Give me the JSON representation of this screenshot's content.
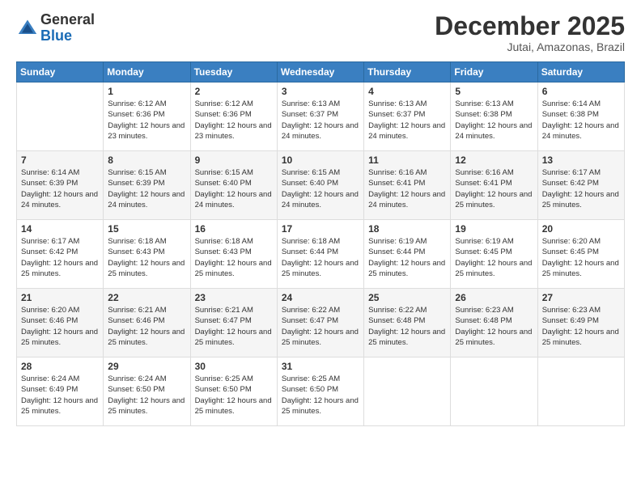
{
  "logo": {
    "text_general": "General",
    "text_blue": "Blue"
  },
  "header": {
    "month": "December 2025",
    "location": "Jutai, Amazonas, Brazil"
  },
  "weekdays": [
    "Sunday",
    "Monday",
    "Tuesday",
    "Wednesday",
    "Thursday",
    "Friday",
    "Saturday"
  ],
  "weeks": [
    [
      {
        "day": "",
        "sunrise": "",
        "sunset": "",
        "daylight": ""
      },
      {
        "day": "1",
        "sunrise": "Sunrise: 6:12 AM",
        "sunset": "Sunset: 6:36 PM",
        "daylight": "Daylight: 12 hours and 23 minutes."
      },
      {
        "day": "2",
        "sunrise": "Sunrise: 6:12 AM",
        "sunset": "Sunset: 6:36 PM",
        "daylight": "Daylight: 12 hours and 23 minutes."
      },
      {
        "day": "3",
        "sunrise": "Sunrise: 6:13 AM",
        "sunset": "Sunset: 6:37 PM",
        "daylight": "Daylight: 12 hours and 24 minutes."
      },
      {
        "day": "4",
        "sunrise": "Sunrise: 6:13 AM",
        "sunset": "Sunset: 6:37 PM",
        "daylight": "Daylight: 12 hours and 24 minutes."
      },
      {
        "day": "5",
        "sunrise": "Sunrise: 6:13 AM",
        "sunset": "Sunset: 6:38 PM",
        "daylight": "Daylight: 12 hours and 24 minutes."
      },
      {
        "day": "6",
        "sunrise": "Sunrise: 6:14 AM",
        "sunset": "Sunset: 6:38 PM",
        "daylight": "Daylight: 12 hours and 24 minutes."
      }
    ],
    [
      {
        "day": "7",
        "sunrise": "Sunrise: 6:14 AM",
        "sunset": "Sunset: 6:39 PM",
        "daylight": "Daylight: 12 hours and 24 minutes."
      },
      {
        "day": "8",
        "sunrise": "Sunrise: 6:15 AM",
        "sunset": "Sunset: 6:39 PM",
        "daylight": "Daylight: 12 hours and 24 minutes."
      },
      {
        "day": "9",
        "sunrise": "Sunrise: 6:15 AM",
        "sunset": "Sunset: 6:40 PM",
        "daylight": "Daylight: 12 hours and 24 minutes."
      },
      {
        "day": "10",
        "sunrise": "Sunrise: 6:15 AM",
        "sunset": "Sunset: 6:40 PM",
        "daylight": "Daylight: 12 hours and 24 minutes."
      },
      {
        "day": "11",
        "sunrise": "Sunrise: 6:16 AM",
        "sunset": "Sunset: 6:41 PM",
        "daylight": "Daylight: 12 hours and 24 minutes."
      },
      {
        "day": "12",
        "sunrise": "Sunrise: 6:16 AM",
        "sunset": "Sunset: 6:41 PM",
        "daylight": "Daylight: 12 hours and 25 minutes."
      },
      {
        "day": "13",
        "sunrise": "Sunrise: 6:17 AM",
        "sunset": "Sunset: 6:42 PM",
        "daylight": "Daylight: 12 hours and 25 minutes."
      }
    ],
    [
      {
        "day": "14",
        "sunrise": "Sunrise: 6:17 AM",
        "sunset": "Sunset: 6:42 PM",
        "daylight": "Daylight: 12 hours and 25 minutes."
      },
      {
        "day": "15",
        "sunrise": "Sunrise: 6:18 AM",
        "sunset": "Sunset: 6:43 PM",
        "daylight": "Daylight: 12 hours and 25 minutes."
      },
      {
        "day": "16",
        "sunrise": "Sunrise: 6:18 AM",
        "sunset": "Sunset: 6:43 PM",
        "daylight": "Daylight: 12 hours and 25 minutes."
      },
      {
        "day": "17",
        "sunrise": "Sunrise: 6:18 AM",
        "sunset": "Sunset: 6:44 PM",
        "daylight": "Daylight: 12 hours and 25 minutes."
      },
      {
        "day": "18",
        "sunrise": "Sunrise: 6:19 AM",
        "sunset": "Sunset: 6:44 PM",
        "daylight": "Daylight: 12 hours and 25 minutes."
      },
      {
        "day": "19",
        "sunrise": "Sunrise: 6:19 AM",
        "sunset": "Sunset: 6:45 PM",
        "daylight": "Daylight: 12 hours and 25 minutes."
      },
      {
        "day": "20",
        "sunrise": "Sunrise: 6:20 AM",
        "sunset": "Sunset: 6:45 PM",
        "daylight": "Daylight: 12 hours and 25 minutes."
      }
    ],
    [
      {
        "day": "21",
        "sunrise": "Sunrise: 6:20 AM",
        "sunset": "Sunset: 6:46 PM",
        "daylight": "Daylight: 12 hours and 25 minutes."
      },
      {
        "day": "22",
        "sunrise": "Sunrise: 6:21 AM",
        "sunset": "Sunset: 6:46 PM",
        "daylight": "Daylight: 12 hours and 25 minutes."
      },
      {
        "day": "23",
        "sunrise": "Sunrise: 6:21 AM",
        "sunset": "Sunset: 6:47 PM",
        "daylight": "Daylight: 12 hours and 25 minutes."
      },
      {
        "day": "24",
        "sunrise": "Sunrise: 6:22 AM",
        "sunset": "Sunset: 6:47 PM",
        "daylight": "Daylight: 12 hours and 25 minutes."
      },
      {
        "day": "25",
        "sunrise": "Sunrise: 6:22 AM",
        "sunset": "Sunset: 6:48 PM",
        "daylight": "Daylight: 12 hours and 25 minutes."
      },
      {
        "day": "26",
        "sunrise": "Sunrise: 6:23 AM",
        "sunset": "Sunset: 6:48 PM",
        "daylight": "Daylight: 12 hours and 25 minutes."
      },
      {
        "day": "27",
        "sunrise": "Sunrise: 6:23 AM",
        "sunset": "Sunset: 6:49 PM",
        "daylight": "Daylight: 12 hours and 25 minutes."
      }
    ],
    [
      {
        "day": "28",
        "sunrise": "Sunrise: 6:24 AM",
        "sunset": "Sunset: 6:49 PM",
        "daylight": "Daylight: 12 hours and 25 minutes."
      },
      {
        "day": "29",
        "sunrise": "Sunrise: 6:24 AM",
        "sunset": "Sunset: 6:50 PM",
        "daylight": "Daylight: 12 hours and 25 minutes."
      },
      {
        "day": "30",
        "sunrise": "Sunrise: 6:25 AM",
        "sunset": "Sunset: 6:50 PM",
        "daylight": "Daylight: 12 hours and 25 minutes."
      },
      {
        "day": "31",
        "sunrise": "Sunrise: 6:25 AM",
        "sunset": "Sunset: 6:50 PM",
        "daylight": "Daylight: 12 hours and 25 minutes."
      },
      {
        "day": "",
        "sunrise": "",
        "sunset": "",
        "daylight": ""
      },
      {
        "day": "",
        "sunrise": "",
        "sunset": "",
        "daylight": ""
      },
      {
        "day": "",
        "sunrise": "",
        "sunset": "",
        "daylight": ""
      }
    ]
  ]
}
